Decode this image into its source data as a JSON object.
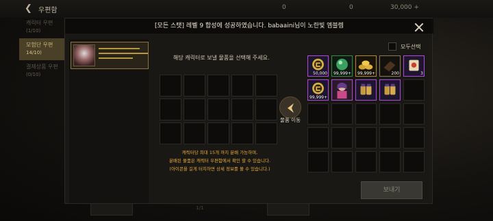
{
  "topbar": {
    "title": "우편함",
    "resources": [
      "0",
      "0",
      "30,000 +"
    ]
  },
  "left_tabs": [
    {
      "label": "캐릭터 우편",
      "sub": "(1/10)"
    },
    {
      "label": "모험단 우편",
      "sub": "14/10)"
    },
    {
      "label": "결제상품 우편",
      "sub": "(0/10)"
    }
  ],
  "page_indicator": "1/1",
  "notification": {
    "prefix": "[모든 스탯] 레벨 9 합성에 성공하였습니다.",
    "suffix": "babaaini님이 노란빛 엠블렘"
  },
  "modal": {
    "instruction": "해당 캐릭터로 보낼 물품을 선택해 주세요.",
    "notes": [
      "캐릭터당 최대 15개 까지 분배 가능하며,",
      "분배된 물품은 캐릭터 우편함에서 확인 할 수 있습니다.",
      "(아이콘을 길게 터치하면 상세 정보를 볼 수 있습니다.)"
    ],
    "move_label": "물품 이동",
    "select_all_label": "모두선택",
    "send_label": "보내기"
  },
  "items": [
    {
      "name": "gold-coin-item",
      "qty": "50,000",
      "color": "#b04ad8"
    },
    {
      "name": "green-orb-item",
      "qty": "99,999+",
      "color": "#3a8a4a"
    },
    {
      "name": "gold-pile-item",
      "qty": "99,999+",
      "color": "#b08a30"
    },
    {
      "name": "dark-box-item",
      "qty": "200",
      "color": "#8a7a5a"
    },
    {
      "name": "scroll-item",
      "qty": "3",
      "color": "#b04ad8"
    },
    {
      "name": "gold-coin-item",
      "qty": "99,999+",
      "color": "#b04ad8"
    },
    {
      "name": "character-card-item",
      "qty": "",
      "color": "#b04ad8"
    },
    {
      "name": "potion-item",
      "qty": "",
      "color": "#b04ad8"
    },
    {
      "name": "potion-item",
      "qty": "",
      "color": "#b04ad8"
    }
  ]
}
